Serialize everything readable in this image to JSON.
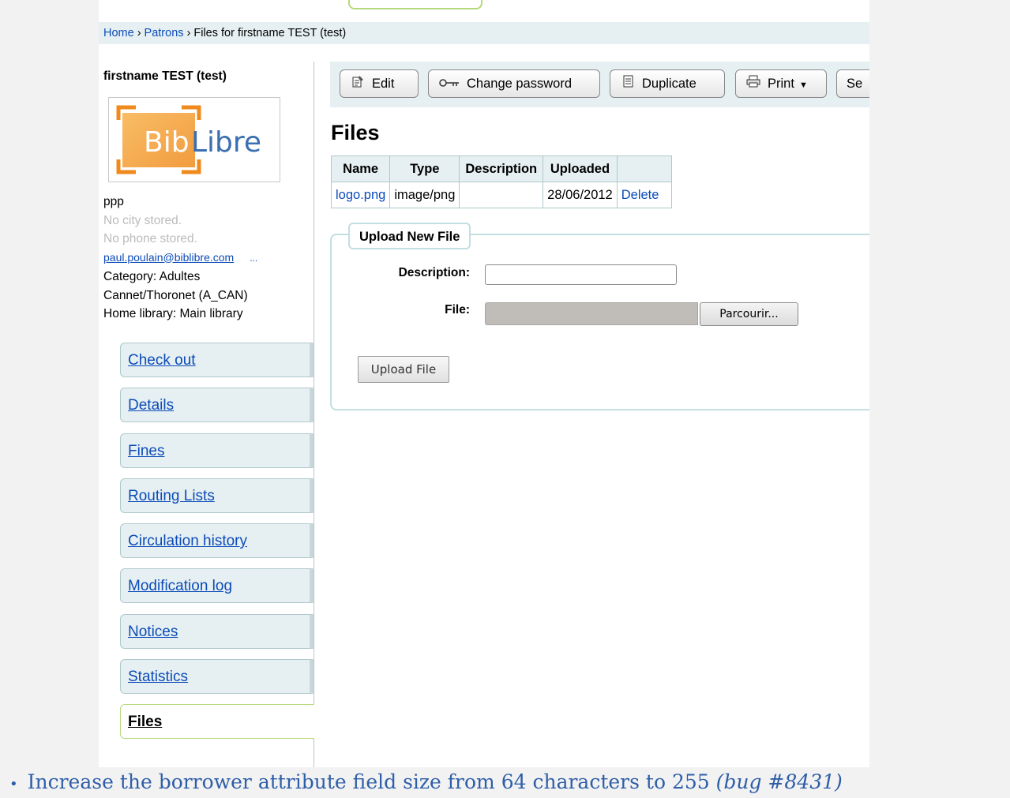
{
  "breadcrumb": [
    {
      "label": "Home",
      "link": true
    },
    {
      "label": "Patrons",
      "link": true
    },
    {
      "label": "Files for firstname TEST (test)",
      "link": false
    }
  ],
  "breadcrumb_separator": "›",
  "patron": {
    "name": "firstname TEST (test)",
    "photo_text_left": "Bib",
    "photo_text_right": "Libre",
    "address": "ppp",
    "city": "No city stored.",
    "phone": "No phone stored.",
    "email": "paul.poulain@biblibre.com",
    "email_more": "...",
    "category": "Category: Adultes Cannet/Thoronet (A_CAN)",
    "home_library": "Home library: Main library"
  },
  "nav": [
    {
      "label": "Check out"
    },
    {
      "label": "Details"
    },
    {
      "label": "Fines"
    },
    {
      "label": "Routing Lists"
    },
    {
      "label": "Circulation history"
    },
    {
      "label": "Modification log"
    },
    {
      "label": "Notices"
    },
    {
      "label": "Statistics"
    },
    {
      "label": "Files",
      "active": true
    }
  ],
  "toolbar": {
    "edit": "Edit",
    "change_password": "Change password",
    "duplicate": "Duplicate",
    "print": "Print",
    "search_partial": "Se"
  },
  "files": {
    "heading": "Files",
    "columns": [
      "Name",
      "Type",
      "Description",
      "Uploaded",
      ""
    ],
    "rows": [
      {
        "name": "logo.png",
        "type": "image/png",
        "description": "",
        "uploaded": "28/06/2012",
        "action": "Delete"
      }
    ]
  },
  "upload": {
    "legend": "Upload New File",
    "description_label": "Description:",
    "description_value": "",
    "file_label": "File:",
    "browse_label": "Parcourir...",
    "submit_label": "Upload File"
  },
  "release_note": {
    "text": "Increase the borrower attribute field size from 64 characters to 255",
    "bug": "(bug #8431)"
  },
  "colors": {
    "link": "#0c4bb8",
    "panel_bg": "#e6f0f2",
    "active_border": "#b7d97e",
    "photo_orange": "#f39c12"
  }
}
